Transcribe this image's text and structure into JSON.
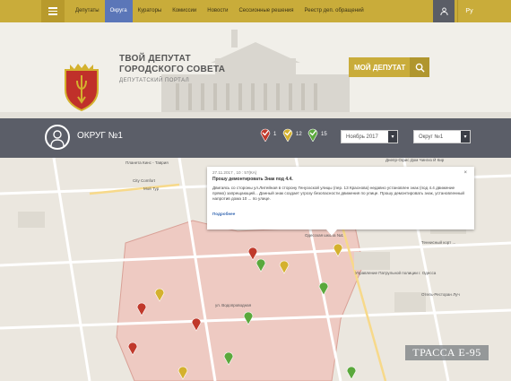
{
  "nav": {
    "items": [
      {
        "label": "Депутаты",
        "active": false
      },
      {
        "label": "Округа",
        "active": true
      },
      {
        "label": "Кураторы",
        "active": false
      },
      {
        "label": "Комиссии",
        "active": false
      },
      {
        "label": "Новости",
        "active": false
      },
      {
        "label": "Сессионные решения",
        "active": false
      },
      {
        "label": "Реестр деп. обращений",
        "active": false
      }
    ],
    "lang": "Ру"
  },
  "hero": {
    "title_line1": "ТВОЙ ДЕПУТАТ",
    "title_line2": "ГОРОДСКОГО СОВЕТА",
    "subtitle": "ДЕПУТАТСКИЙ ПОРТАЛ",
    "my_deputy_label": "МОЙ ДЕПУТАТ"
  },
  "district": {
    "title": "ОКРУГ №1",
    "legend": [
      {
        "count": "1",
        "color": "#c0392b"
      },
      {
        "count": "12",
        "color": "#d4b12e"
      },
      {
        "count": "15",
        "color": "#5aa83c"
      }
    ],
    "month_select": "Ноябрь 2017",
    "district_select": "Округ №1"
  },
  "popup": {
    "date": "27.11.2017 , 10 : 57(КА)",
    "title": "Прошу демонтировать Знак под 4.4.",
    "text": "Двигаясь со стороны ул.Литейная в сторону Генуэзской улицы (пер. 13 Краснова) недавно установлен знак (под 4.4 движение прямо) запрещающий... Данный знак создает угрозу безопасности движения по улице. Прошу демонтировать знак, установленный напротив дома 10 ... по улице.",
    "more_label": "Подробнее",
    "close_glyph": "×"
  },
  "map": {
    "labels": [
      "Планета Кинс - Таврия",
      "Днепр-Офис Дом Чингиз Й Кир",
      "City Comfort",
      "Мой Тур",
      "Одесская школа №1",
      "Управление Патрульной полиции г. Одесса",
      "Теннисный корт ...",
      "Отель-Ресторан Луч",
      "ул. Водопроводная"
    ],
    "watermark": "ТРАССА Е-95"
  }
}
